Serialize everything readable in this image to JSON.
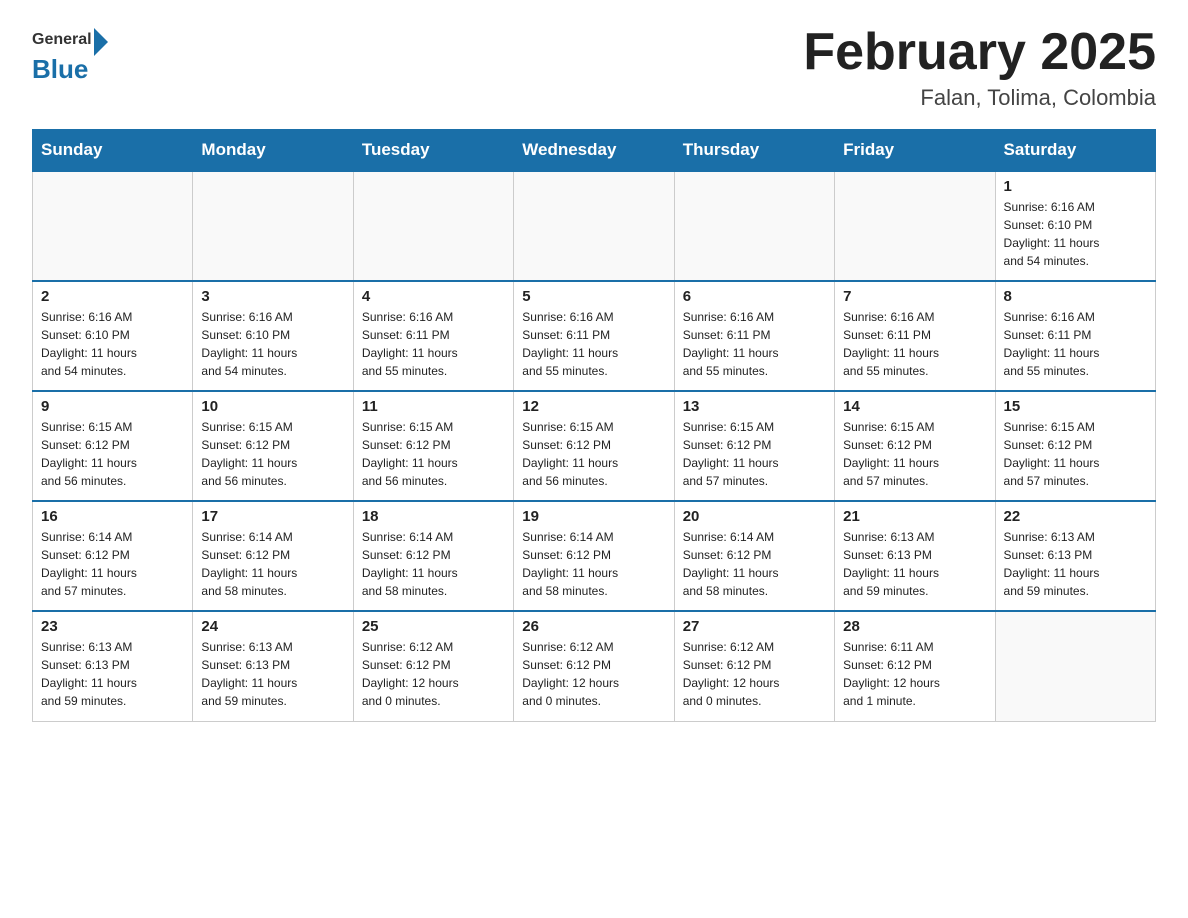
{
  "header": {
    "logo_general": "General",
    "logo_blue": "Blue",
    "month": "February 2025",
    "location": "Falan, Tolima, Colombia"
  },
  "days_of_week": [
    "Sunday",
    "Monday",
    "Tuesday",
    "Wednesday",
    "Thursday",
    "Friday",
    "Saturday"
  ],
  "weeks": [
    [
      {
        "num": "",
        "info": ""
      },
      {
        "num": "",
        "info": ""
      },
      {
        "num": "",
        "info": ""
      },
      {
        "num": "",
        "info": ""
      },
      {
        "num": "",
        "info": ""
      },
      {
        "num": "",
        "info": ""
      },
      {
        "num": "1",
        "info": "Sunrise: 6:16 AM\nSunset: 6:10 PM\nDaylight: 11 hours\nand 54 minutes."
      }
    ],
    [
      {
        "num": "2",
        "info": "Sunrise: 6:16 AM\nSunset: 6:10 PM\nDaylight: 11 hours\nand 54 minutes."
      },
      {
        "num": "3",
        "info": "Sunrise: 6:16 AM\nSunset: 6:10 PM\nDaylight: 11 hours\nand 54 minutes."
      },
      {
        "num": "4",
        "info": "Sunrise: 6:16 AM\nSunset: 6:11 PM\nDaylight: 11 hours\nand 55 minutes."
      },
      {
        "num": "5",
        "info": "Sunrise: 6:16 AM\nSunset: 6:11 PM\nDaylight: 11 hours\nand 55 minutes."
      },
      {
        "num": "6",
        "info": "Sunrise: 6:16 AM\nSunset: 6:11 PM\nDaylight: 11 hours\nand 55 minutes."
      },
      {
        "num": "7",
        "info": "Sunrise: 6:16 AM\nSunset: 6:11 PM\nDaylight: 11 hours\nand 55 minutes."
      },
      {
        "num": "8",
        "info": "Sunrise: 6:16 AM\nSunset: 6:11 PM\nDaylight: 11 hours\nand 55 minutes."
      }
    ],
    [
      {
        "num": "9",
        "info": "Sunrise: 6:15 AM\nSunset: 6:12 PM\nDaylight: 11 hours\nand 56 minutes."
      },
      {
        "num": "10",
        "info": "Sunrise: 6:15 AM\nSunset: 6:12 PM\nDaylight: 11 hours\nand 56 minutes."
      },
      {
        "num": "11",
        "info": "Sunrise: 6:15 AM\nSunset: 6:12 PM\nDaylight: 11 hours\nand 56 minutes."
      },
      {
        "num": "12",
        "info": "Sunrise: 6:15 AM\nSunset: 6:12 PM\nDaylight: 11 hours\nand 56 minutes."
      },
      {
        "num": "13",
        "info": "Sunrise: 6:15 AM\nSunset: 6:12 PM\nDaylight: 11 hours\nand 57 minutes."
      },
      {
        "num": "14",
        "info": "Sunrise: 6:15 AM\nSunset: 6:12 PM\nDaylight: 11 hours\nand 57 minutes."
      },
      {
        "num": "15",
        "info": "Sunrise: 6:15 AM\nSunset: 6:12 PM\nDaylight: 11 hours\nand 57 minutes."
      }
    ],
    [
      {
        "num": "16",
        "info": "Sunrise: 6:14 AM\nSunset: 6:12 PM\nDaylight: 11 hours\nand 57 minutes."
      },
      {
        "num": "17",
        "info": "Sunrise: 6:14 AM\nSunset: 6:12 PM\nDaylight: 11 hours\nand 58 minutes."
      },
      {
        "num": "18",
        "info": "Sunrise: 6:14 AM\nSunset: 6:12 PM\nDaylight: 11 hours\nand 58 minutes."
      },
      {
        "num": "19",
        "info": "Sunrise: 6:14 AM\nSunset: 6:12 PM\nDaylight: 11 hours\nand 58 minutes."
      },
      {
        "num": "20",
        "info": "Sunrise: 6:14 AM\nSunset: 6:12 PM\nDaylight: 11 hours\nand 58 minutes."
      },
      {
        "num": "21",
        "info": "Sunrise: 6:13 AM\nSunset: 6:13 PM\nDaylight: 11 hours\nand 59 minutes."
      },
      {
        "num": "22",
        "info": "Sunrise: 6:13 AM\nSunset: 6:13 PM\nDaylight: 11 hours\nand 59 minutes."
      }
    ],
    [
      {
        "num": "23",
        "info": "Sunrise: 6:13 AM\nSunset: 6:13 PM\nDaylight: 11 hours\nand 59 minutes."
      },
      {
        "num": "24",
        "info": "Sunrise: 6:13 AM\nSunset: 6:13 PM\nDaylight: 11 hours\nand 59 minutes."
      },
      {
        "num": "25",
        "info": "Sunrise: 6:12 AM\nSunset: 6:12 PM\nDaylight: 12 hours\nand 0 minutes."
      },
      {
        "num": "26",
        "info": "Sunrise: 6:12 AM\nSunset: 6:12 PM\nDaylight: 12 hours\nand 0 minutes."
      },
      {
        "num": "27",
        "info": "Sunrise: 6:12 AM\nSunset: 6:12 PM\nDaylight: 12 hours\nand 0 minutes."
      },
      {
        "num": "28",
        "info": "Sunrise: 6:11 AM\nSunset: 6:12 PM\nDaylight: 12 hours\nand 1 minute."
      },
      {
        "num": "",
        "info": ""
      }
    ]
  ]
}
